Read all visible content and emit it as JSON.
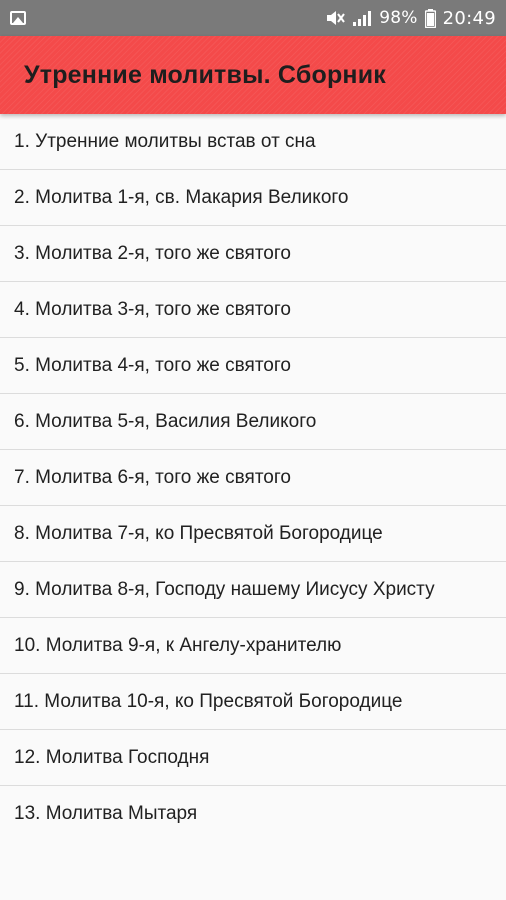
{
  "status_bar": {
    "battery_percent": "98%",
    "time": "20:49",
    "icons": [
      "image-notification-icon",
      "mute-icon",
      "signal-icon",
      "battery-icon"
    ]
  },
  "app_bar": {
    "title": "Утренние молитвы. Сборник",
    "color": "#f44a4a"
  },
  "prayers": [
    {
      "label": "1. Утренние молитвы встав от сна"
    },
    {
      "label": "2. Молитва 1-я, св. Макария Великого"
    },
    {
      "label": "3. Молитва 2-я, того же святого"
    },
    {
      "label": "4. Молитва 3-я, того же святого"
    },
    {
      "label": "5. Молитва 4-я, того же святого"
    },
    {
      "label": "6. Молитва 5-я, Василия Великого"
    },
    {
      "label": "7. Молитва 6-я, того же святого"
    },
    {
      "label": "8. Молитва 7-я, ко Пресвятой Богородице"
    },
    {
      "label": "9. Молитва 8-я, Господу нашему Иисусу Христу"
    },
    {
      "label": "10. Молитва 9-я, к Ангелу-хранителю"
    },
    {
      "label": "11. Молитва 10-я, ко Пресвятой Богородице"
    },
    {
      "label": "12. Молитва Господня"
    },
    {
      "label": "13. Молитва Мытаря"
    }
  ]
}
